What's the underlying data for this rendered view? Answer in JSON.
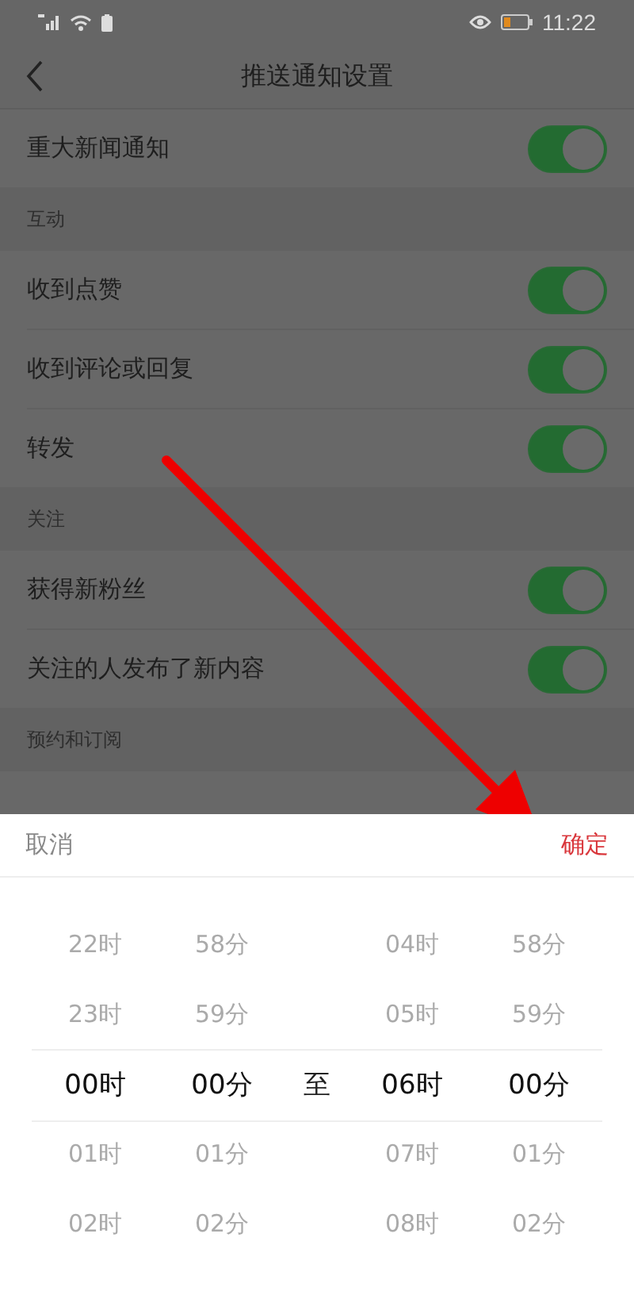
{
  "status_bar": {
    "time": "11:22"
  },
  "header": {
    "title": "推送通知设置"
  },
  "sections": [
    {
      "items": [
        {
          "label": "重大新闻通知",
          "on": true
        }
      ]
    },
    {
      "title": "互动",
      "items": [
        {
          "label": "收到点赞",
          "on": true
        },
        {
          "label": "收到评论或回复",
          "on": true
        },
        {
          "label": "转发",
          "on": true
        }
      ]
    },
    {
      "title": "关注",
      "items": [
        {
          "label": "获得新粉丝",
          "on": true
        },
        {
          "label": "关注的人发布了新内容",
          "on": true
        }
      ]
    },
    {
      "title": "预约和订阅"
    }
  ],
  "sheet": {
    "cancel": "取消",
    "confirm": "确定",
    "separator": "至",
    "columns": [
      {
        "items": [
          {
            "label": "22时",
            "selected": false
          },
          {
            "label": "23时",
            "selected": false
          },
          {
            "label": "00时",
            "selected": true
          },
          {
            "label": "01时",
            "selected": false
          },
          {
            "label": "02时",
            "selected": false
          }
        ]
      },
      {
        "items": [
          {
            "label": "58分",
            "selected": false
          },
          {
            "label": "59分",
            "selected": false
          },
          {
            "label": "00分",
            "selected": true
          },
          {
            "label": "01分",
            "selected": false
          },
          {
            "label": "02分",
            "selected": false
          }
        ]
      },
      {
        "items": [
          {
            "label": "04时",
            "selected": false
          },
          {
            "label": "05时",
            "selected": false
          },
          {
            "label": "06时",
            "selected": true
          },
          {
            "label": "07时",
            "selected": false
          },
          {
            "label": "08时",
            "selected": false
          }
        ]
      },
      {
        "items": [
          {
            "label": "58分",
            "selected": false
          },
          {
            "label": "59分",
            "selected": false
          },
          {
            "label": "00分",
            "selected": true
          },
          {
            "label": "01分",
            "selected": false
          },
          {
            "label": "02分",
            "selected": false
          }
        ]
      }
    ]
  }
}
